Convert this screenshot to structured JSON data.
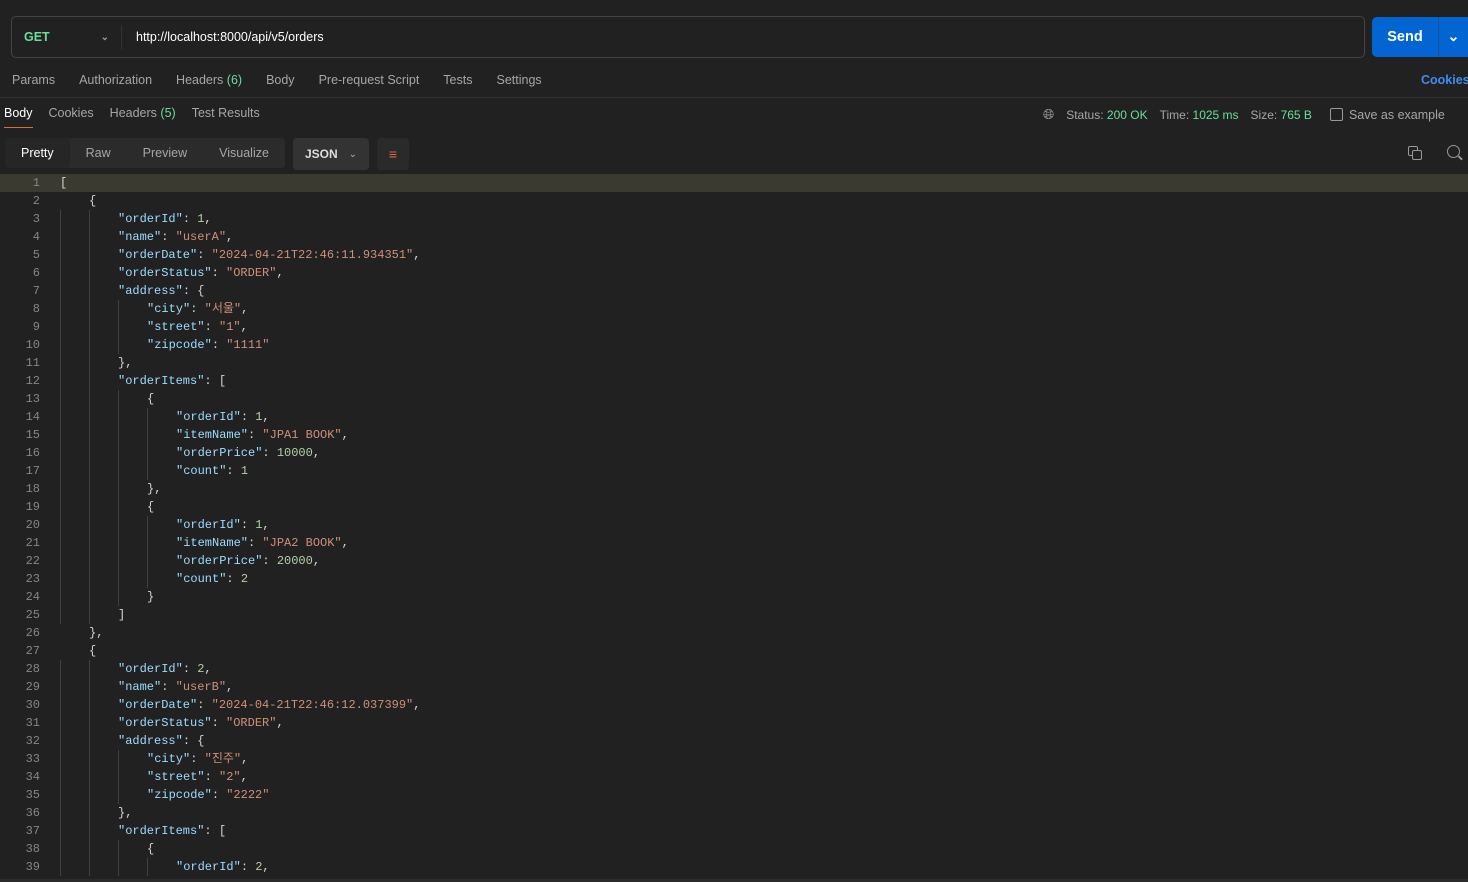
{
  "request": {
    "method": "GET",
    "url": "http://localhost:8000/api/v5/orders",
    "send_label": "Send"
  },
  "request_tabs": [
    {
      "label": "Params"
    },
    {
      "label": "Authorization"
    },
    {
      "label": "Headers",
      "count": "(6)"
    },
    {
      "label": "Body"
    },
    {
      "label": "Pre-request Script"
    },
    {
      "label": "Tests"
    },
    {
      "label": "Settings"
    }
  ],
  "cookies_link": "Cookies",
  "response_tabs": [
    {
      "label": "Body",
      "active": true
    },
    {
      "label": "Cookies"
    },
    {
      "label": "Headers",
      "count": "(5)"
    },
    {
      "label": "Test Results"
    }
  ],
  "status": {
    "status_label": "Status:",
    "status_value": "200 OK",
    "time_label": "Time:",
    "time_value": "1025 ms",
    "size_label": "Size:",
    "size_value": "765 B",
    "save_label": "Save as example"
  },
  "view_modes": [
    "Pretty",
    "Raw",
    "Preview",
    "Visualize"
  ],
  "format": "JSON",
  "colors": {
    "key": "#9cdcfe",
    "string": "#ce9178",
    "number": "#b5cea8",
    "accent": "#0265d2",
    "success": "#6bdd9a"
  },
  "code_lines": [
    {
      "i": 0,
      "t": "["
    },
    {
      "i": 1,
      "t": "{"
    },
    {
      "i": 2,
      "t": "\"orderId\": 1,"
    },
    {
      "i": 2,
      "t": "\"name\": \"userA\","
    },
    {
      "i": 2,
      "t": "\"orderDate\": \"2024-04-21T22:46:11.934351\","
    },
    {
      "i": 2,
      "t": "\"orderStatus\": \"ORDER\","
    },
    {
      "i": 2,
      "t": "\"address\": {"
    },
    {
      "i": 3,
      "t": "\"city\": \"서울\","
    },
    {
      "i": 3,
      "t": "\"street\": \"1\","
    },
    {
      "i": 3,
      "t": "\"zipcode\": \"1111\""
    },
    {
      "i": 2,
      "t": "},"
    },
    {
      "i": 2,
      "t": "\"orderItems\": ["
    },
    {
      "i": 3,
      "t": "{"
    },
    {
      "i": 4,
      "t": "\"orderId\": 1,"
    },
    {
      "i": 4,
      "t": "\"itemName\": \"JPA1 BOOK\","
    },
    {
      "i": 4,
      "t": "\"orderPrice\": 10000,"
    },
    {
      "i": 4,
      "t": "\"count\": 1"
    },
    {
      "i": 3,
      "t": "},"
    },
    {
      "i": 3,
      "t": "{"
    },
    {
      "i": 4,
      "t": "\"orderId\": 1,"
    },
    {
      "i": 4,
      "t": "\"itemName\": \"JPA2 BOOK\","
    },
    {
      "i": 4,
      "t": "\"orderPrice\": 20000,"
    },
    {
      "i": 4,
      "t": "\"count\": 2"
    },
    {
      "i": 3,
      "t": "}"
    },
    {
      "i": 2,
      "t": "]"
    },
    {
      "i": 1,
      "t": "},"
    },
    {
      "i": 1,
      "t": "{"
    },
    {
      "i": 2,
      "t": "\"orderId\": 2,"
    },
    {
      "i": 2,
      "t": "\"name\": \"userB\","
    },
    {
      "i": 2,
      "t": "\"orderDate\": \"2024-04-21T22:46:12.037399\","
    },
    {
      "i": 2,
      "t": "\"orderStatus\": \"ORDER\","
    },
    {
      "i": 2,
      "t": "\"address\": {"
    },
    {
      "i": 3,
      "t": "\"city\": \"진주\","
    },
    {
      "i": 3,
      "t": "\"street\": \"2\","
    },
    {
      "i": 3,
      "t": "\"zipcode\": \"2222\""
    },
    {
      "i": 2,
      "t": "},"
    },
    {
      "i": 2,
      "t": "\"orderItems\": ["
    },
    {
      "i": 3,
      "t": "{"
    },
    {
      "i": 4,
      "t": "\"orderId\": 2,"
    }
  ]
}
